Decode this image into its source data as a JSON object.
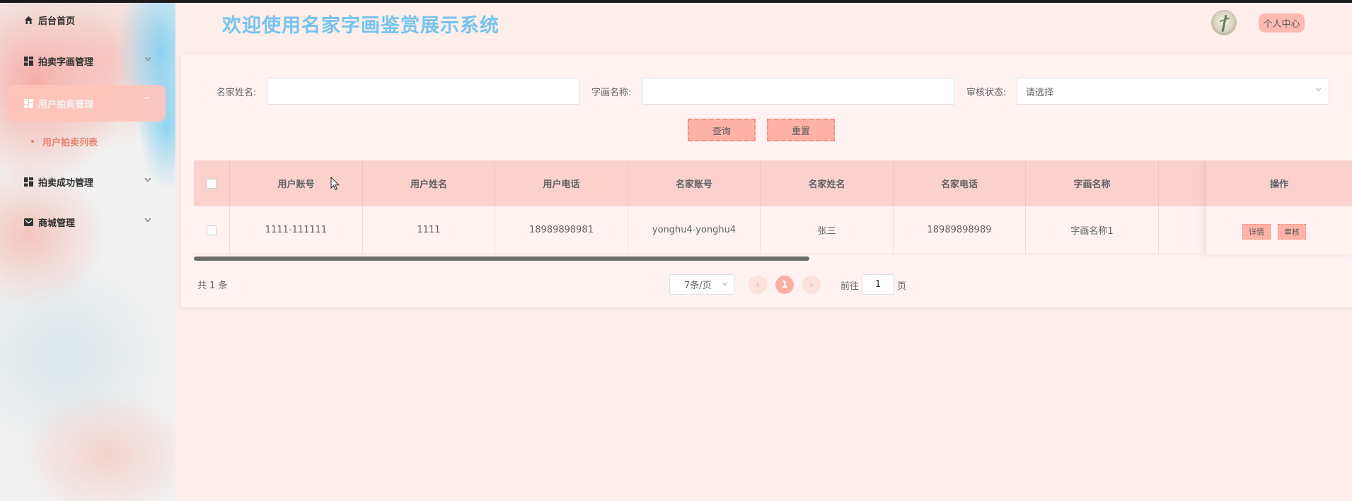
{
  "header": {
    "title": "欢迎使用名家字画鉴赏展示系统",
    "personal_center": "个人中心"
  },
  "sidebar": {
    "items": [
      {
        "label": "后台首页",
        "icon": "home-icon"
      },
      {
        "label": "拍卖字画管理",
        "icon": "grid-icon"
      },
      {
        "label": "用户拍卖管理",
        "icon": "grid-icon"
      },
      {
        "label": "拍卖成功管理",
        "icon": "grid-icon"
      },
      {
        "label": "商城管理",
        "icon": "mail-icon"
      }
    ],
    "active_sub_item": "用户拍卖列表"
  },
  "search": {
    "artist_name_label": "名家姓名:",
    "artist_name_value": "",
    "painting_name_label": "字画名称:",
    "painting_name_value": "",
    "audit_status_label": "审核状态:",
    "audit_status_value": "请选择",
    "query_button": "查询",
    "reset_button": "重置"
  },
  "table": {
    "columns": [
      "用户账号",
      "用户姓名",
      "用户电话",
      "名家账号",
      "名家姓名",
      "名家电话",
      "字画名称"
    ],
    "ops_header": "操作",
    "rows": [
      {
        "cells": [
          "1111-111111",
          "1111",
          "18989898981",
          "yonghu4-yonghu4",
          "张三",
          "18989898989",
          "字画名称1"
        ]
      }
    ],
    "detail_button": "详情",
    "audit_button": "审核"
  },
  "pagination": {
    "total_text": "共 1 条",
    "page_size": "7条/页",
    "current_page": "1",
    "prev_icon": "chevron-left-icon",
    "next_icon": "chevron-right-icon",
    "goto_label": "前往",
    "goto_value": "1",
    "goto_suffix": "页"
  },
  "colors": {
    "accent": "#fbb0a4",
    "title": "#76c3ee",
    "background": "#fdeeec"
  }
}
